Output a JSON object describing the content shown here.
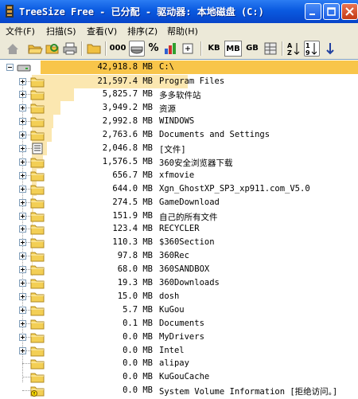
{
  "window": {
    "title": "TreeSize Free - 已分配 - 驱动器: 本地磁盘 (C:)"
  },
  "menu": [
    {
      "label": "文件(F)"
    },
    {
      "label": "扫描(S)"
    },
    {
      "label": "查看(V)"
    },
    {
      "label": "排序(Z)"
    },
    {
      "label": "帮助(H)"
    }
  ],
  "toolbar": {
    "percent_label": "%",
    "zero_label": "000",
    "kb": "KB",
    "mb": "MB",
    "gb": "GB"
  },
  "colors": {
    "bar": "#fbe7b0",
    "root_bar": "#f8c54a",
    "titlebar": "#0a5ae0"
  },
  "root": {
    "size": "42,918.8 MB",
    "name": "C:\\"
  },
  "items": [
    {
      "size": "21,597.4 MB",
      "name": "Program Files",
      "share": 0.503,
      "icon": "folder",
      "expander": "plus"
    },
    {
      "size": "5,825.7 MB",
      "name": "多多软件站",
      "share": 0.136,
      "icon": "folder",
      "expander": "plus"
    },
    {
      "size": "3,949.2 MB",
      "name": "资源",
      "share": 0.092,
      "icon": "folder",
      "expander": "plus"
    },
    {
      "size": "2,992.8 MB",
      "name": "WINDOWS",
      "share": 0.07,
      "icon": "folder",
      "expander": "plus"
    },
    {
      "size": "2,763.6 MB",
      "name": "Documents and Settings",
      "share": 0.064,
      "icon": "folder",
      "expander": "plus"
    },
    {
      "size": "2,046.8 MB",
      "name": "[文件]",
      "share": 0.048,
      "icon": "files",
      "expander": "plus"
    },
    {
      "size": "1,576.5 MB",
      "name": "360安全浏览器下载",
      "share": 0.037,
      "icon": "folder",
      "expander": "plus"
    },
    {
      "size": "656.7 MB",
      "name": "xfmovie",
      "share": 0.015,
      "icon": "folder",
      "expander": "plus"
    },
    {
      "size": "644.0 MB",
      "name": "Xgn_GhostXP_SP3_xp911.com_V5.0",
      "share": 0.015,
      "icon": "folder",
      "expander": "plus"
    },
    {
      "size": "274.5 MB",
      "name": "GameDownload",
      "share": 0.006,
      "icon": "folder",
      "expander": "plus"
    },
    {
      "size": "151.9 MB",
      "name": "自己的所有文件",
      "share": 0.004,
      "icon": "folder",
      "expander": "plus"
    },
    {
      "size": "123.4 MB",
      "name": "RECYCLER",
      "share": 0.003,
      "icon": "folder",
      "expander": "plus"
    },
    {
      "size": "110.3 MB",
      "name": "$360Section",
      "share": 0.003,
      "icon": "folder",
      "expander": "plus"
    },
    {
      "size": "97.8 MB",
      "name": "360Rec",
      "share": 0.002,
      "icon": "folder",
      "expander": "plus"
    },
    {
      "size": "68.0 MB",
      "name": "360SANDBOX",
      "share": 0.002,
      "icon": "folder",
      "expander": "plus"
    },
    {
      "size": "19.3 MB",
      "name": "360Downloads",
      "share": 0.0,
      "icon": "folder",
      "expander": "plus"
    },
    {
      "size": "15.0 MB",
      "name": "dosh",
      "share": 0.0,
      "icon": "folder",
      "expander": "plus"
    },
    {
      "size": "5.7 MB",
      "name": "KuGou",
      "share": 0.0,
      "icon": "folder",
      "expander": "plus"
    },
    {
      "size": "0.1 MB",
      "name": "Documents",
      "share": 0.0,
      "icon": "folder",
      "expander": "plus"
    },
    {
      "size": "0.0 MB",
      "name": "MyDrivers",
      "share": 0.0,
      "icon": "folder",
      "expander": "plus"
    },
    {
      "size": "0.0 MB",
      "name": "Intel",
      "share": 0.0,
      "icon": "folder",
      "expander": "plus"
    },
    {
      "size": "0.0 MB",
      "name": "alipay",
      "share": 0.0,
      "icon": "folder",
      "expander": "none"
    },
    {
      "size": "0.0 MB",
      "name": "KuGouCache",
      "share": 0.0,
      "icon": "folder",
      "expander": "none"
    },
    {
      "size": "0.0 MB",
      "name": "System Volume Information  [拒绝访问。]",
      "share": 0.0,
      "icon": "folder-warning",
      "expander": "none"
    }
  ]
}
